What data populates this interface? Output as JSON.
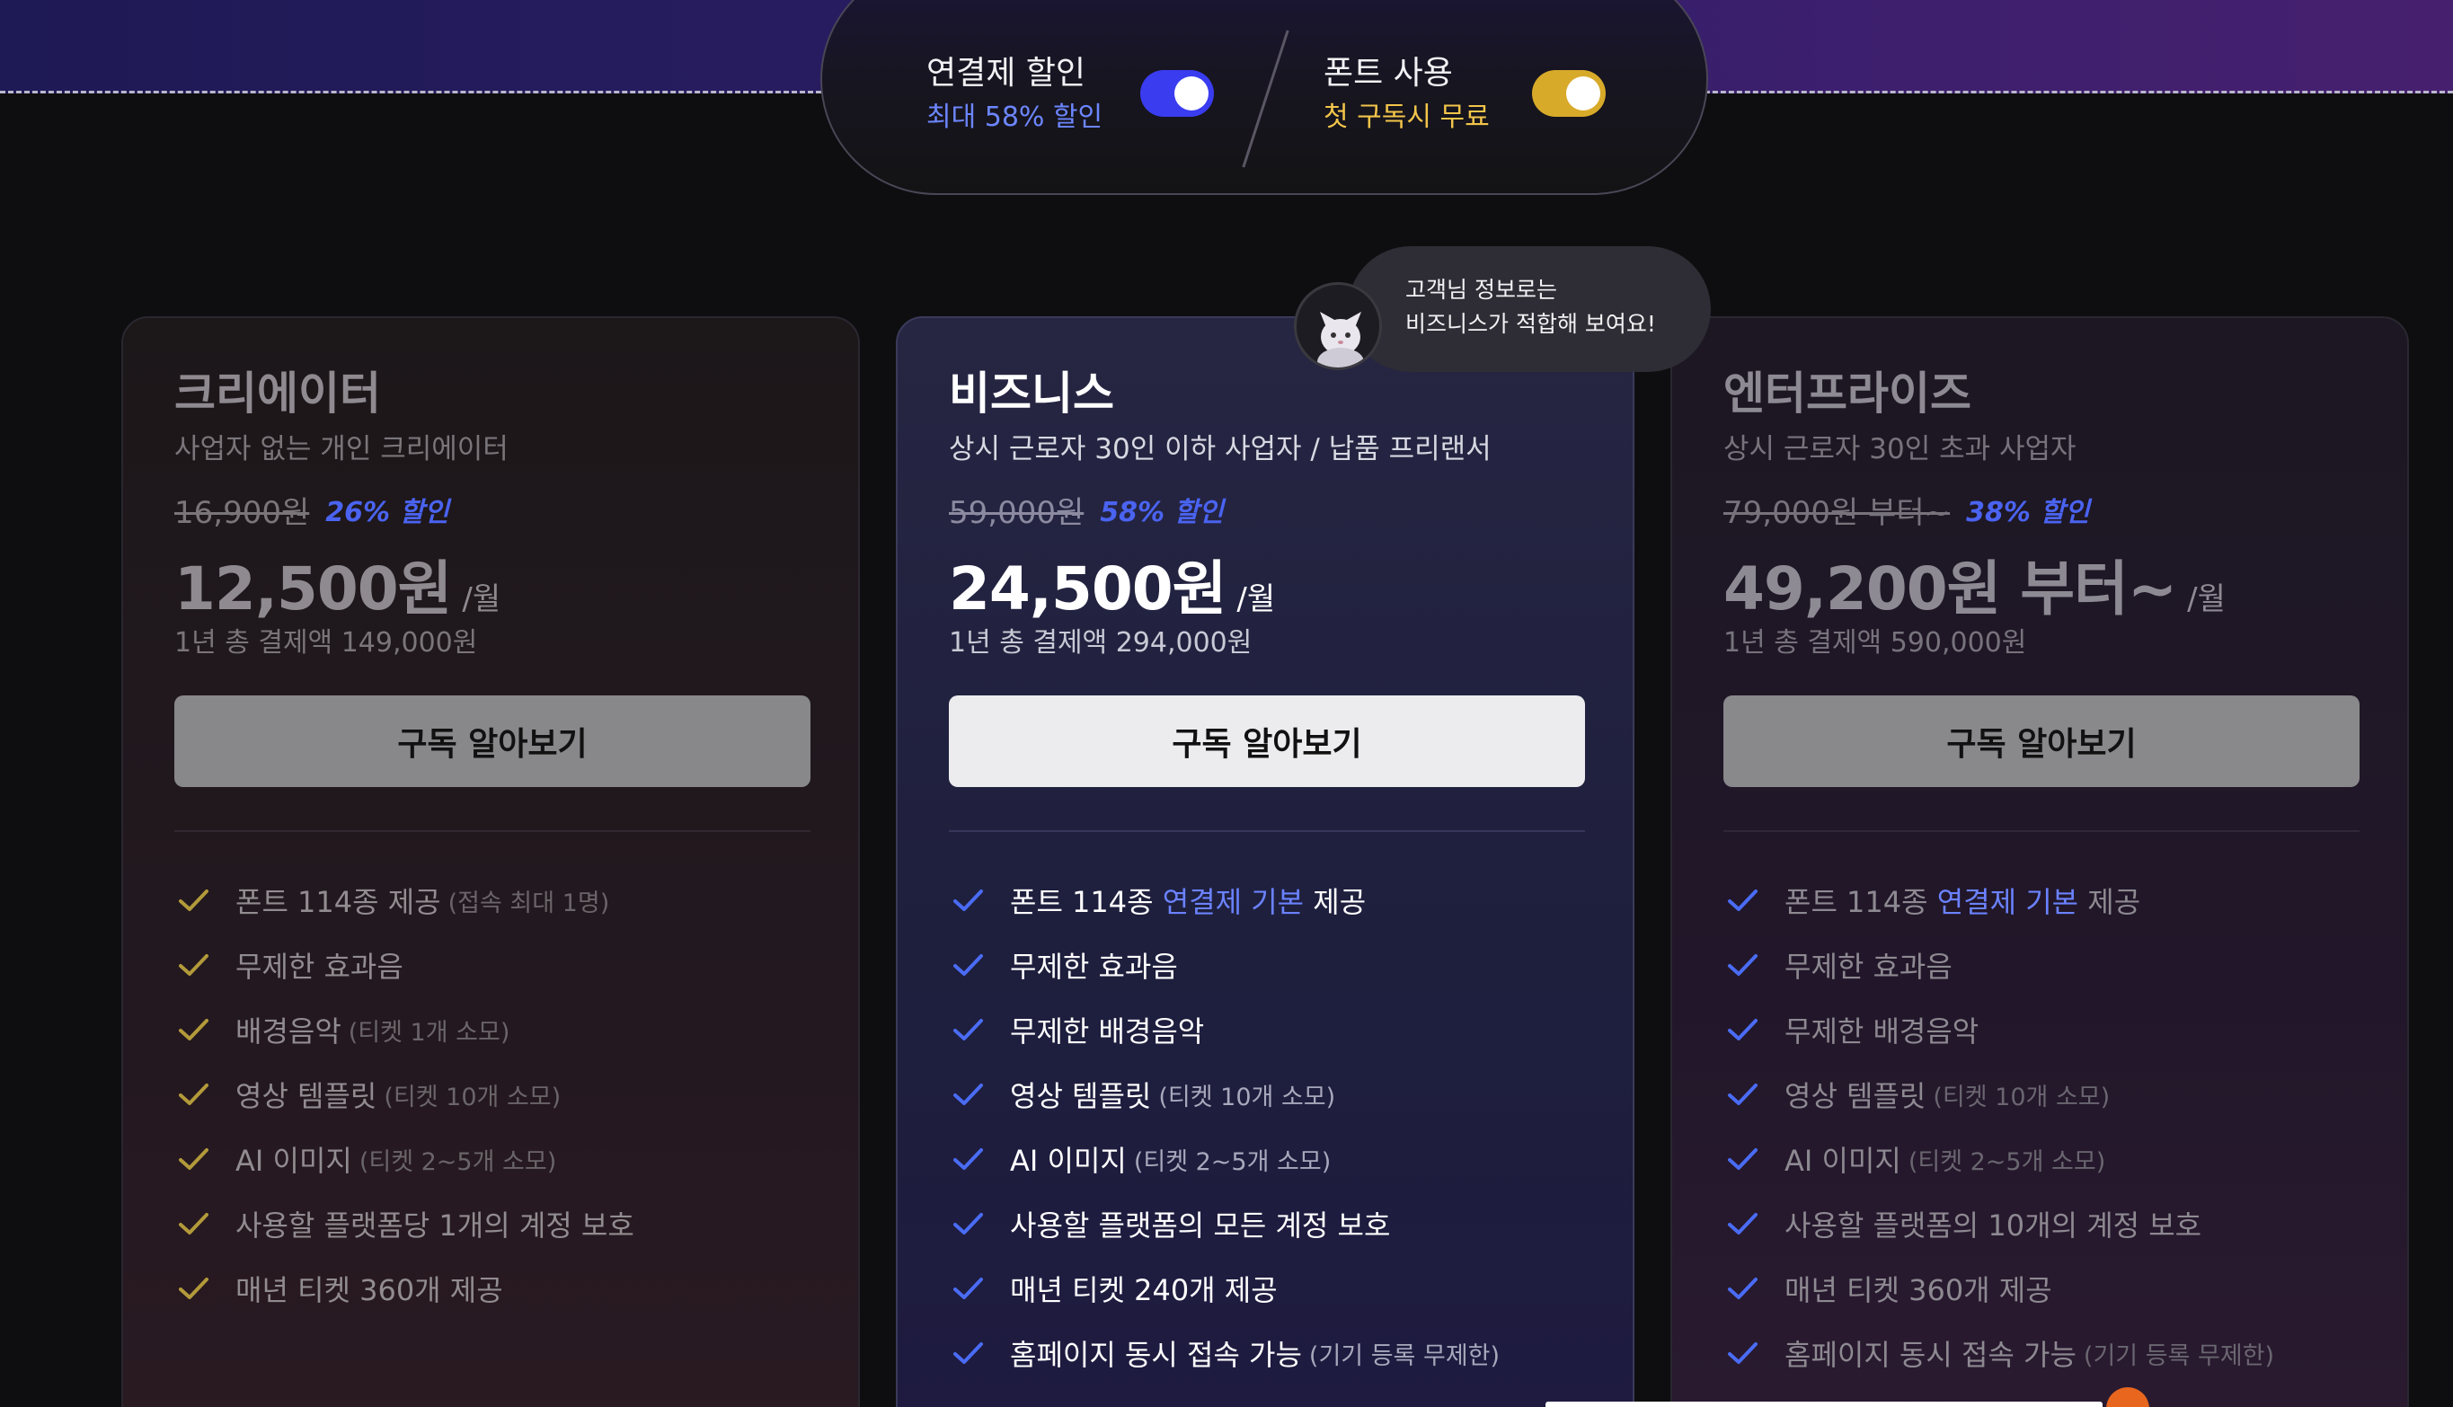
{
  "toggles": {
    "bundle": {
      "title": "연결제 할인",
      "subtitle": "최대 58% 할인",
      "on": true,
      "color": "#3a3cf0"
    },
    "font": {
      "title": "폰트 사용",
      "subtitle": "첫 구독시 무료",
      "on": true,
      "color": "#d8aa2a"
    }
  },
  "tooltip": {
    "line1": "고객님 정보로는",
    "line2": "비즈니스가 적합해 보여요!",
    "avatar_icon": "cat-avatar-icon"
  },
  "plans": [
    {
      "name": "크리에이터",
      "desc": "사업자 없는 개인 크리에이터",
      "orig_price": "16,900원",
      "discount": "26% 할인",
      "price": "12,500원",
      "per": "/월",
      "annual": "1년 총 결제액 149,000원",
      "cta": "구독 알아보기",
      "check_color": "#b39a3a",
      "features": [
        {
          "text": "폰트 114종 제공",
          "note": "(접속 최대 1명)"
        },
        {
          "text": "무제한 효과음",
          "note": ""
        },
        {
          "text": "배경음악",
          "note": "(티켓 1개 소모)"
        },
        {
          "text": "영상 템플릿",
          "note": "(티켓 10개 소모)"
        },
        {
          "text": "AI 이미지",
          "note": "(티켓 2~5개 소모)"
        },
        {
          "text": "사용할 플랫폼당 1개의 계정 보호",
          "note": ""
        },
        {
          "text": "매년 티켓 360개 제공",
          "note": ""
        }
      ]
    },
    {
      "name": "비즈니스",
      "desc": "상시 근로자 30인 이하 사업자 / 납품 프리랜서",
      "orig_price": "59,000원",
      "discount": "58% 할인",
      "price": "24,500원",
      "per": "/월",
      "annual": "1년 총 결제액 294,000원",
      "cta": "구독 알아보기",
      "check_color": "#4a6cf5",
      "features": [
        {
          "pre": "폰트 114종",
          "hl": "연결제 기본",
          "post": "제공"
        },
        {
          "text": "무제한 효과음",
          "note": ""
        },
        {
          "text": "무제한 배경음악",
          "note": ""
        },
        {
          "text": "영상 템플릿",
          "note": "(티켓 10개 소모)"
        },
        {
          "text": "AI 이미지",
          "note": "(티켓 2~5개 소모)"
        },
        {
          "text": "사용할 플랫폼의 모든 계정 보호",
          "note": ""
        },
        {
          "text": "매년 티켓 240개 제공",
          "note": ""
        },
        {
          "text": "홈페이지 동시 접속 가능",
          "note": "(기기 등록 무제한)"
        }
      ]
    },
    {
      "name": "엔터프라이즈",
      "desc": "상시 근로자 30인 초과 사업자",
      "orig_price": "79,000원 부터~",
      "discount": "38% 할인",
      "price": "49,200원 부터~",
      "per": "/월",
      "annual": "1년 총 결제액 590,000원",
      "cta": "구독 알아보기",
      "check_color": "#4a6cf5",
      "features": [
        {
          "pre": "폰트 114종",
          "hl": "연결제 기본",
          "post": "제공"
        },
        {
          "text": "무제한 효과음",
          "note": ""
        },
        {
          "text": "무제한 배경음악",
          "note": ""
        },
        {
          "text": "영상 템플릿",
          "note": "(티켓 10개 소모)"
        },
        {
          "text": "AI 이미지",
          "note": "(티켓 2~5개 소모)"
        },
        {
          "text": "사용할 플랫폼의 10개의 계정 보호",
          "note": ""
        },
        {
          "text": "매년 티켓 360개 제공",
          "note": ""
        },
        {
          "text": "홈페이지 동시 접속 가능",
          "note": "(기기 등록 무제한)"
        }
      ]
    }
  ]
}
